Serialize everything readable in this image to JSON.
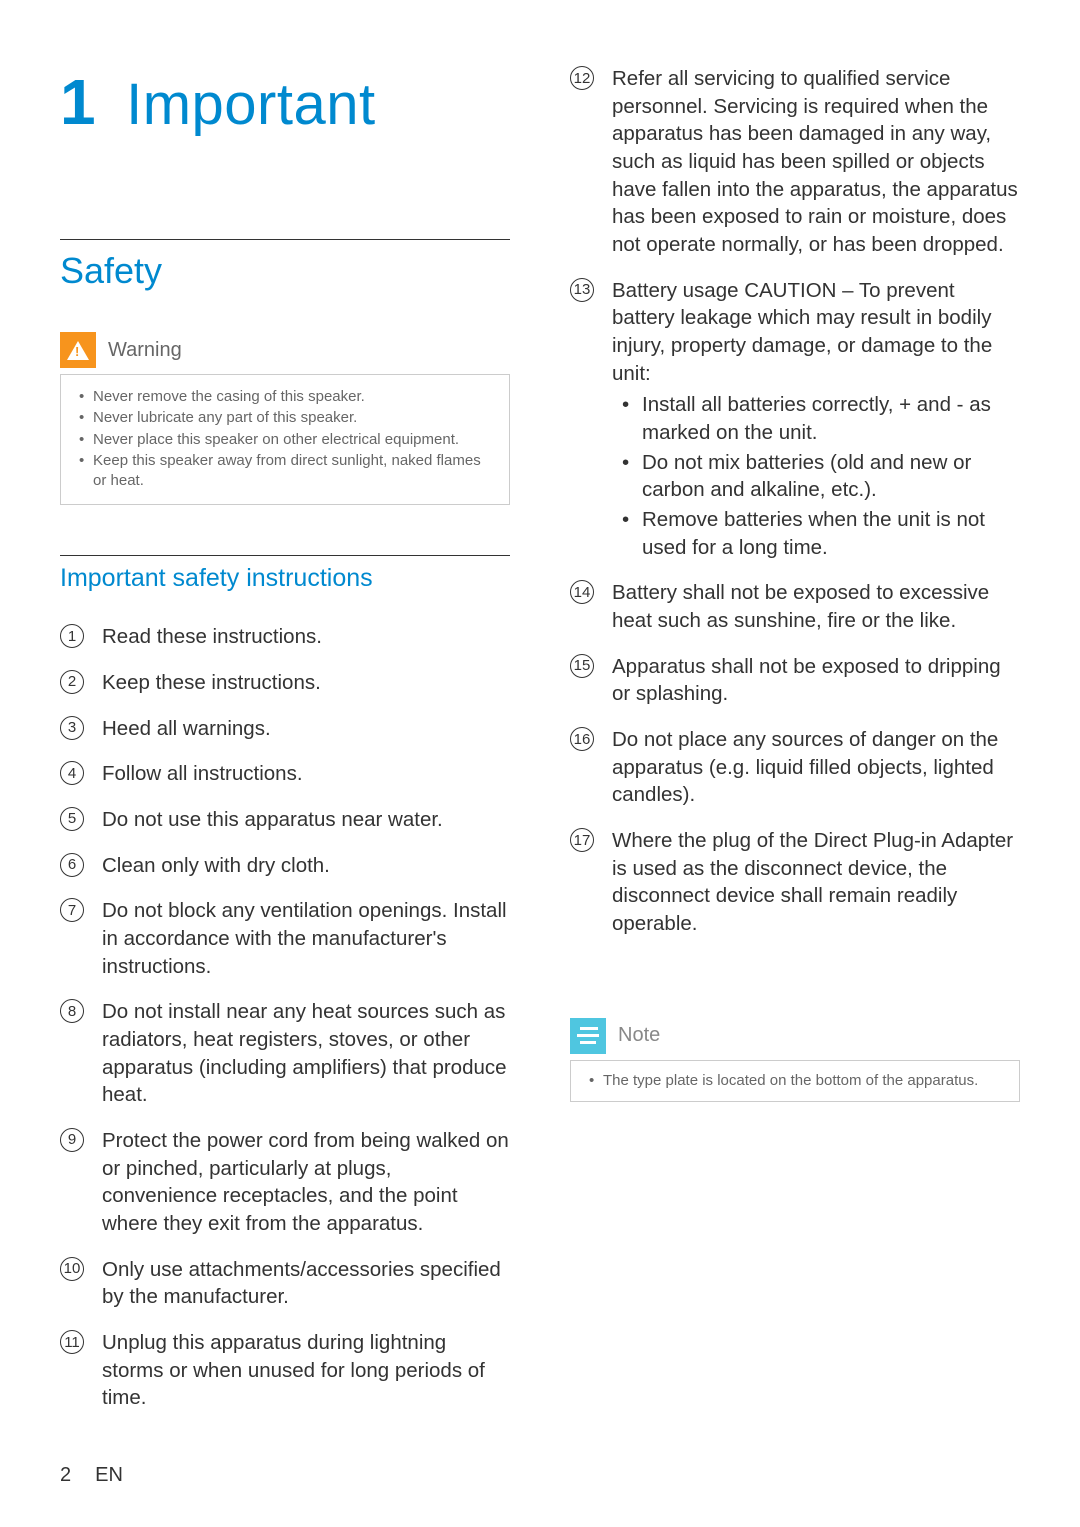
{
  "chapter": {
    "num": "1",
    "title": "Important"
  },
  "section": {
    "title": "Safety"
  },
  "warning": {
    "label": "Warning",
    "items": [
      "Never remove the casing of this speaker.",
      "Never lubricate any part of this speaker.",
      "Never place this speaker on other electrical equipment.",
      "Keep this speaker away from direct sunlight, naked flames or heat."
    ]
  },
  "subsection": {
    "title": "Important safety instructions"
  },
  "instructions_left": [
    {
      "n": "1",
      "text": "Read these instructions."
    },
    {
      "n": "2",
      "text": "Keep these instructions."
    },
    {
      "n": "3",
      "text": "Heed all warnings."
    },
    {
      "n": "4",
      "text": "Follow all instructions."
    },
    {
      "n": "5",
      "text": "Do not use this apparatus near water."
    },
    {
      "n": "6",
      "text": "Clean only with dry cloth."
    },
    {
      "n": "7",
      "text": "Do not block any ventilation openings. Install in accordance with the manufacturer's instructions."
    },
    {
      "n": "8",
      "text": "Do not install near any heat sources such as radiators, heat registers, stoves, or other apparatus (including amplifiers) that produce heat."
    },
    {
      "n": "9",
      "text": "Protect the power cord from being walked on or pinched, particularly at plugs, convenience receptacles, and the point where they exit from the apparatus."
    },
    {
      "n": "10",
      "text": "Only use attachments/accessories specified by the manufacturer."
    },
    {
      "n": "11",
      "text": "Unplug this apparatus during lightning storms or when unused for long periods of time."
    }
  ],
  "instructions_right": [
    {
      "n": "12",
      "text": "Refer all servicing to qualified service personnel. Servicing is required when the apparatus has been damaged in any way, such as liquid has been spilled or objects have fallen into the apparatus, the apparatus has been exposed to rain or moisture, does not operate normally, or has been dropped."
    },
    {
      "n": "13",
      "text": "Battery usage CAUTION – To prevent battery leakage which may result in bodily injury, property damage, or damage to the unit:",
      "sub": [
        "Install all batteries correctly, + and - as marked on the unit.",
        "Do not mix batteries (old and new or carbon and alkaline, etc.).",
        "Remove batteries when the unit is not used for a long time."
      ]
    },
    {
      "n": "14",
      "text": "Battery shall not be exposed to excessive heat such as sunshine, fire or the like."
    },
    {
      "n": "15",
      "text": "Apparatus shall not be exposed to dripping or splashing."
    },
    {
      "n": "16",
      "text": "Do not place any sources of danger on the apparatus (e.g. liquid filled objects, lighted candles)."
    },
    {
      "n": "17",
      "text": "Where the plug of the Direct Plug-in Adapter is used as the disconnect device, the disconnect device shall remain readily operable."
    }
  ],
  "note": {
    "label": "Note",
    "items": [
      "The type plate is located on the bottom of the apparatus."
    ]
  },
  "footer": {
    "page": "2",
    "lang": "EN"
  }
}
